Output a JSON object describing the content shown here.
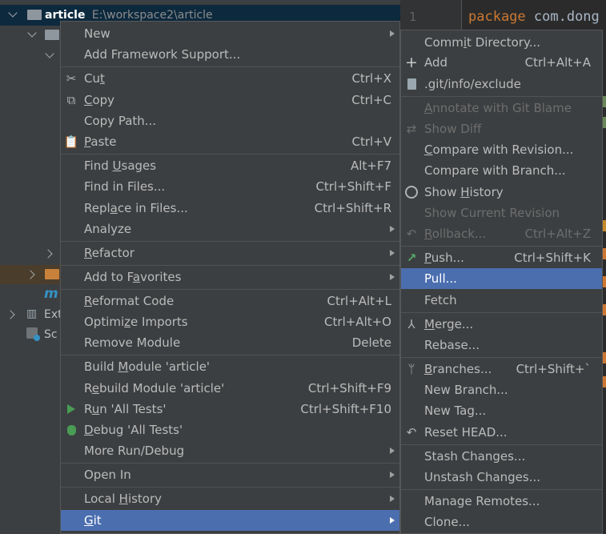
{
  "tree": {
    "project_name": "article",
    "project_path": "E:\\workspace2\\article",
    "row_m_label": "m",
    "row_external_label": "Ext",
    "row_scratches_label": "Sc"
  },
  "editor": {
    "line_number": "1",
    "code_keyword": "package",
    "code_rest": " com.dong"
  },
  "context_menu": {
    "new": {
      "label": "New"
    },
    "add_framework_support": {
      "label": "Add Framework Support..."
    },
    "cut": {
      "label_pre": "Cu",
      "mnemonic": "t",
      "label_post": "",
      "shortcut": "Ctrl+X"
    },
    "copy": {
      "label_pre": "",
      "mnemonic": "C",
      "label_post": "opy",
      "shortcut": "Ctrl+C"
    },
    "copy_path": {
      "label": "Copy Path..."
    },
    "paste": {
      "label_pre": "",
      "mnemonic": "P",
      "label_post": "aste",
      "shortcut": "Ctrl+V"
    },
    "find_usages": {
      "label_pre": "Find ",
      "mnemonic": "U",
      "label_post": "sages",
      "shortcut": "Alt+F7"
    },
    "find_in_files": {
      "label": "Find in Files...",
      "shortcut": "Ctrl+Shift+F"
    },
    "replace_in_files": {
      "label_pre": "Repl",
      "mnemonic": "a",
      "label_post": "ce in Files...",
      "shortcut": "Ctrl+Shift+R"
    },
    "analyze": {
      "label": "Analyze"
    },
    "refactor": {
      "label_pre": "",
      "mnemonic": "R",
      "label_post": "efactor"
    },
    "add_to_favorites": {
      "label_pre": "Add to F",
      "mnemonic": "a",
      "label_post": "vorites"
    },
    "reformat_code": {
      "label_pre": "",
      "mnemonic": "R",
      "label_post": "eformat Code",
      "shortcut": "Ctrl+Alt+L"
    },
    "optimize_imports": {
      "label_pre": "Optimi",
      "mnemonic": "z",
      "label_post": "e Imports",
      "shortcut": "Ctrl+Alt+O"
    },
    "remove_module": {
      "label": "Remove Module",
      "shortcut": "Delete"
    },
    "build_module": {
      "label_pre": "Build ",
      "mnemonic": "M",
      "label_post": "odule 'article'"
    },
    "rebuild_module": {
      "label_pre": "R",
      "mnemonic": "e",
      "label_post": "build Module 'article'",
      "shortcut": "Ctrl+Shift+F9"
    },
    "run_all_tests": {
      "label_pre": "R",
      "mnemonic": "u",
      "label_post": "n 'All Tests'",
      "shortcut": "Ctrl+Shift+F10"
    },
    "debug_all_tests": {
      "label_pre": "",
      "mnemonic": "D",
      "label_post": "ebug 'All Tests'"
    },
    "more_run_debug": {
      "label": "More Run/Debug"
    },
    "open_in": {
      "label": "Open In"
    },
    "local_history": {
      "label_pre": "Local ",
      "mnemonic": "H",
      "label_post": "istory"
    },
    "git": {
      "label_pre": "",
      "mnemonic": "G",
      "label_post": "it"
    }
  },
  "git_menu": {
    "commit_directory": {
      "label_pre": "Comm",
      "mnemonic": "i",
      "label_post": "t Directory..."
    },
    "add": {
      "label": "Add",
      "shortcut": "Ctrl+Alt+A"
    },
    "gitinfo_exclude": {
      "label": ".git/info/exclude"
    },
    "annotate": {
      "label_pre": "",
      "mnemonic": "A",
      "label_post": "nnotate with Git Blame"
    },
    "show_diff": {
      "label": "Show Diff"
    },
    "compare_revision": {
      "label_pre": "",
      "mnemonic": "C",
      "label_post": "ompare with Revision..."
    },
    "compare_branch": {
      "label": "Compare with Branch..."
    },
    "show_history": {
      "label_pre": "Show ",
      "mnemonic": "H",
      "label_post": "istory"
    },
    "show_current_revision": {
      "label": "Show Current Revision"
    },
    "rollback": {
      "label_pre": "",
      "mnemonic": "R",
      "label_post": "ollback...",
      "shortcut": "Ctrl+Alt+Z"
    },
    "push": {
      "label_pre": "",
      "mnemonic": "P",
      "label_post": "ush...",
      "shortcut": "Ctrl+Shift+K"
    },
    "pull": {
      "label": "Pull..."
    },
    "fetch": {
      "label": "Fetch"
    },
    "merge": {
      "label_pre": "",
      "mnemonic": "M",
      "label_post": "erge..."
    },
    "rebase": {
      "label": "Rebase..."
    },
    "branches": {
      "label_pre": "",
      "mnemonic": "B",
      "label_post": "ranches...",
      "shortcut": "Ctrl+Shift+`"
    },
    "new_branch": {
      "label": "New Branch..."
    },
    "new_tag": {
      "label": "New Tag..."
    },
    "reset_head": {
      "label": "Reset HEAD..."
    },
    "stash": {
      "label": "Stash Changes..."
    },
    "unstash": {
      "label": "Unstash Changes..."
    },
    "manage_remotes": {
      "label": "Manage Remotes..."
    },
    "clone": {
      "label": "Clone..."
    }
  },
  "colors": {
    "menu_bg": "#3c3f41",
    "selection": "#4b6eaf",
    "disabled_text": "#6d6d6d",
    "text": "#bbbbbb",
    "editor_keyword": "#cc7832",
    "run_icon": "#499c54",
    "push_icon": "#59a869"
  }
}
